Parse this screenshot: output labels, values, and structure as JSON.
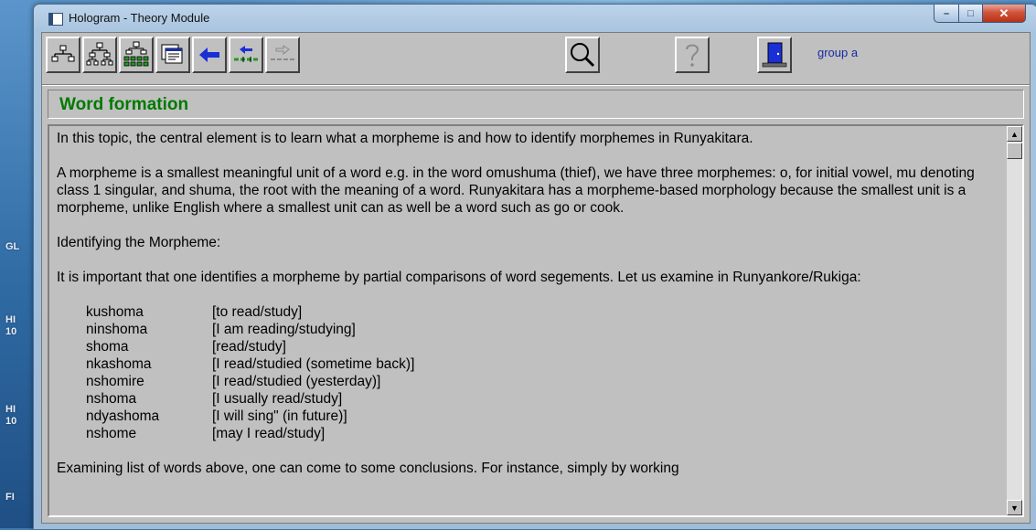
{
  "desktop": {
    "labels": [
      "GL",
      "HI",
      "10",
      "HI",
      "10",
      "FI"
    ]
  },
  "window": {
    "title": "Hologram - Theory Module",
    "controls": {
      "minimize": "–",
      "maximize": "□",
      "close": "✕"
    }
  },
  "toolbar": {
    "buttons": [
      {
        "name": "topic-tree-icon"
      },
      {
        "name": "subtopic-tree-icon"
      },
      {
        "name": "full-tree-icon"
      },
      {
        "name": "pages-icon"
      },
      {
        "name": "back-arrow-icon"
      },
      {
        "name": "previous-page-icon"
      },
      {
        "name": "next-page-icon"
      },
      {
        "name": "magnifier-icon"
      },
      {
        "name": "help-icon"
      },
      {
        "name": "exit-door-icon"
      }
    ],
    "group_label": "group a"
  },
  "heading": "Word formation",
  "content": {
    "para1": "In this topic, the central element is to learn what a morpheme is and how to identify morphemes in Runyakitara.",
    "para2": "A morpheme is a smallest meaningful unit of a word e.g. in the word omushuma (thief), we have three morphemes: o, for initial vowel, mu denoting class 1 singular, and shuma, the root with the meaning of a word. Runyakitara has a morpheme-based morphology because the smallest unit is a morpheme, unlike English where a smallest unit can as well be a word such as go or cook.",
    "para3": "Identifying the Morpheme:",
    "para4": "It is important that one identifies a morpheme by partial comparisons of word segements.  Let us examine in Runyankore/Rukiga:",
    "vocab": [
      {
        "word": "kushoma",
        "gloss": "[to read/study]"
      },
      {
        "word": "ninshoma",
        "gloss": "[I am reading/studying]"
      },
      {
        "word": "shoma",
        "gloss": "[read/study]"
      },
      {
        "word": "nkashoma",
        "gloss": "[I read/studied (sometime back)]"
      },
      {
        "word": "nshomire",
        "gloss": "[I read/studied (yesterday)]"
      },
      {
        "word": "nshoma",
        "gloss": "[I usually read/study]"
      },
      {
        "word": "ndyashoma",
        "gloss": "[I will sing\" (in future)]"
      },
      {
        "word": "nshome",
        "gloss": "[may I read/study]"
      }
    ],
    "para5": "Examining list of words above, one can come to some conclusions.  For instance, simply by working"
  },
  "scrollbar": {
    "up_arrow": "▲",
    "down_arrow": "▼"
  }
}
